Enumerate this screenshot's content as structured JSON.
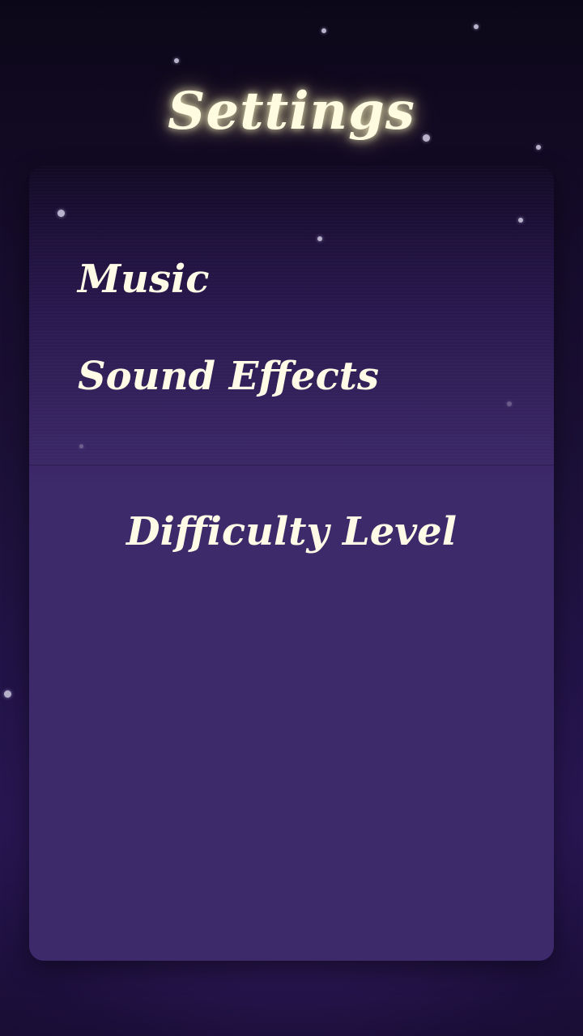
{
  "screen": {
    "title": "Settings"
  },
  "settings": {
    "items": [
      {
        "label": "Music"
      },
      {
        "label": "Sound Effects"
      }
    ]
  },
  "difficulty": {
    "heading": "Difficulty Level"
  },
  "colors": {
    "text": "#fffbe6",
    "title_glow": "#fff8c8",
    "panel": "#3d2a6b",
    "background_top": "#0c0718",
    "background_bottom": "#221446"
  }
}
